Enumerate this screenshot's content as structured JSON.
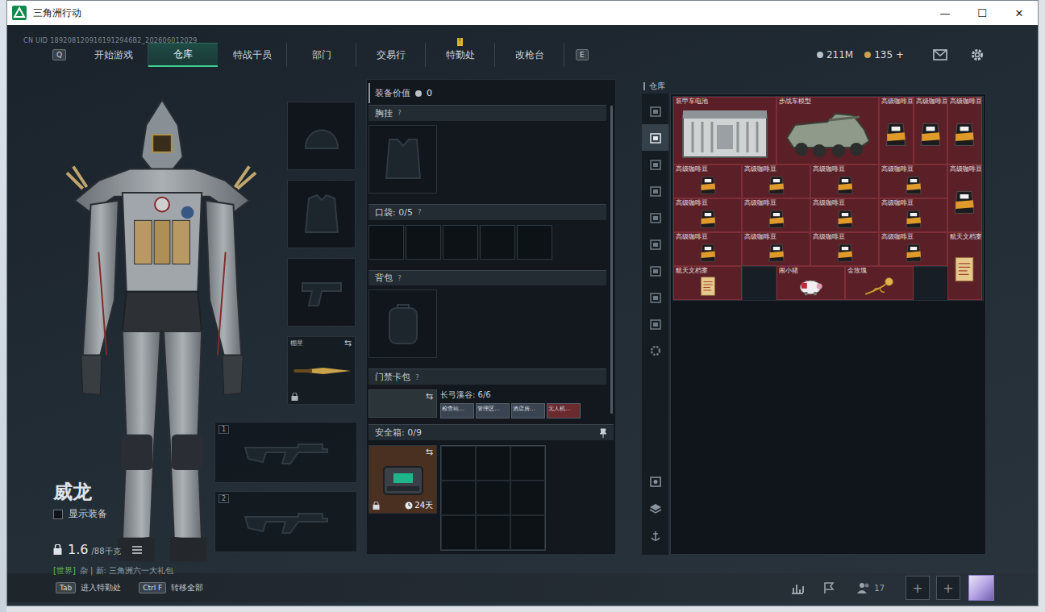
{
  "window": {
    "title": "三角洲行动",
    "controls": [
      "—",
      "☐",
      "✕"
    ]
  },
  "uid": "CN UID 1892081209161912946B2_202606012029",
  "nav": {
    "prev_key": "Q",
    "next_key": "E",
    "tabs": [
      {
        "label": "开始游戏",
        "selected": false,
        "badge": ""
      },
      {
        "label": "仓库",
        "selected": true,
        "badge": ""
      },
      {
        "label": "特战干员",
        "selected": false,
        "badge": ""
      },
      {
        "label": "部门",
        "selected": false,
        "badge": ""
      },
      {
        "label": "交易行",
        "selected": false,
        "badge": ""
      },
      {
        "label": "特勤处",
        "selected": false,
        "badge": "!"
      },
      {
        "label": "改枪台",
        "selected": false,
        "badge": ""
      }
    ]
  },
  "currency": [
    {
      "value": "211M",
      "color": "#b9c0c6"
    },
    {
      "value": "135 +",
      "color": "#c9a24a"
    }
  ],
  "character": {
    "name": "威龙",
    "show_gear": {
      "label": "显示装备",
      "checked": false
    },
    "weight": "1.6",
    "weight_max": "/88千克",
    "chat_channel": "[世界]",
    "chat_text": "杂 | 新: 三角洲六一大礼包"
  },
  "slots": {
    "melee_label": "棚星",
    "weapon_numbers": [
      "1",
      "2"
    ],
    "swap_glyph": "⇆"
  },
  "loadout": {
    "value_label": "装备价值",
    "value": "0",
    "help_glyph": "?",
    "chest": "胸挂",
    "pockets": "口袋: 0/5",
    "backpack": "背包",
    "keycard": "门禁卡包",
    "keycard_map": "长弓溪谷: 6/6",
    "cards": [
      {
        "label": "检查站…",
        "color": "#3a4450"
      },
      {
        "label": "管理区…",
        "color": "#3a4450"
      },
      {
        "label": "酒店房…",
        "color": "#3a4450"
      },
      {
        "label": "无人机…",
        "color": "#6b2a2e"
      }
    ],
    "safe": "安全箱: 0/9",
    "safe_days": "24天"
  },
  "warehouse": {
    "title": "仓库",
    "tabs": [
      {
        "kind": "box",
        "selected": false
      },
      {
        "kind": "box",
        "selected": true
      },
      {
        "kind": "box",
        "selected": false
      },
      {
        "kind": "box",
        "selected": false
      },
      {
        "kind": "box",
        "selected": false
      },
      {
        "kind": "box",
        "selected": false
      },
      {
        "kind": "box",
        "selected": false
      },
      {
        "kind": "box",
        "selected": false
      },
      {
        "kind": "box",
        "selected": false
      },
      {
        "kind": "settings",
        "selected": false
      }
    ],
    "items": [
      {
        "name": "装甲车电池",
        "kind": "battery"
      },
      {
        "name": "步战车模型",
        "kind": "vehicle"
      },
      {
        "name": "高级咖啡豆",
        "kind": "coffee"
      },
      {
        "name": "高级咖啡豆",
        "kind": "coffee"
      },
      {
        "name": "高级咖啡豆",
        "kind": "coffee"
      },
      {
        "name": "高级咖啡豆",
        "kind": "coffee"
      },
      {
        "name": "高级咖啡豆",
        "kind": "coffee"
      },
      {
        "name": "高级咖啡豆",
        "kind": "coffee"
      },
      {
        "name": "高级咖啡豆",
        "kind": "coffee"
      },
      {
        "name": "高级咖啡豆",
        "kind": "coffee"
      },
      {
        "name": "高级咖啡豆",
        "kind": "coffee"
      },
      {
        "name": "高级咖啡豆",
        "kind": "coffee"
      },
      {
        "name": "高级咖啡豆",
        "kind": "coffee"
      },
      {
        "name": "高级咖啡豆",
        "kind": "coffee"
      },
      {
        "name": "高级咖啡豆",
        "kind": "coffee"
      },
      {
        "name": "高级咖啡豆",
        "kind": "coffee"
      },
      {
        "name": "高级咖啡豆",
        "kind": "coffee"
      },
      {
        "name": "高级咖啡豆",
        "kind": "coffee"
      },
      {
        "name": "航天文档案",
        "kind": "document"
      },
      {
        "name": "航天文档案",
        "kind": "document"
      },
      {
        "name": "闹小猪",
        "kind": "pig"
      },
      {
        "name": "金玫瑰",
        "kind": "rose"
      }
    ]
  },
  "bottom": {
    "hints": [
      {
        "key": "Tab",
        "label": "进入特勤处"
      },
      {
        "key": "Ctrl F",
        "label": "转移全部"
      }
    ],
    "friends": "17",
    "add_glyph": "+"
  }
}
